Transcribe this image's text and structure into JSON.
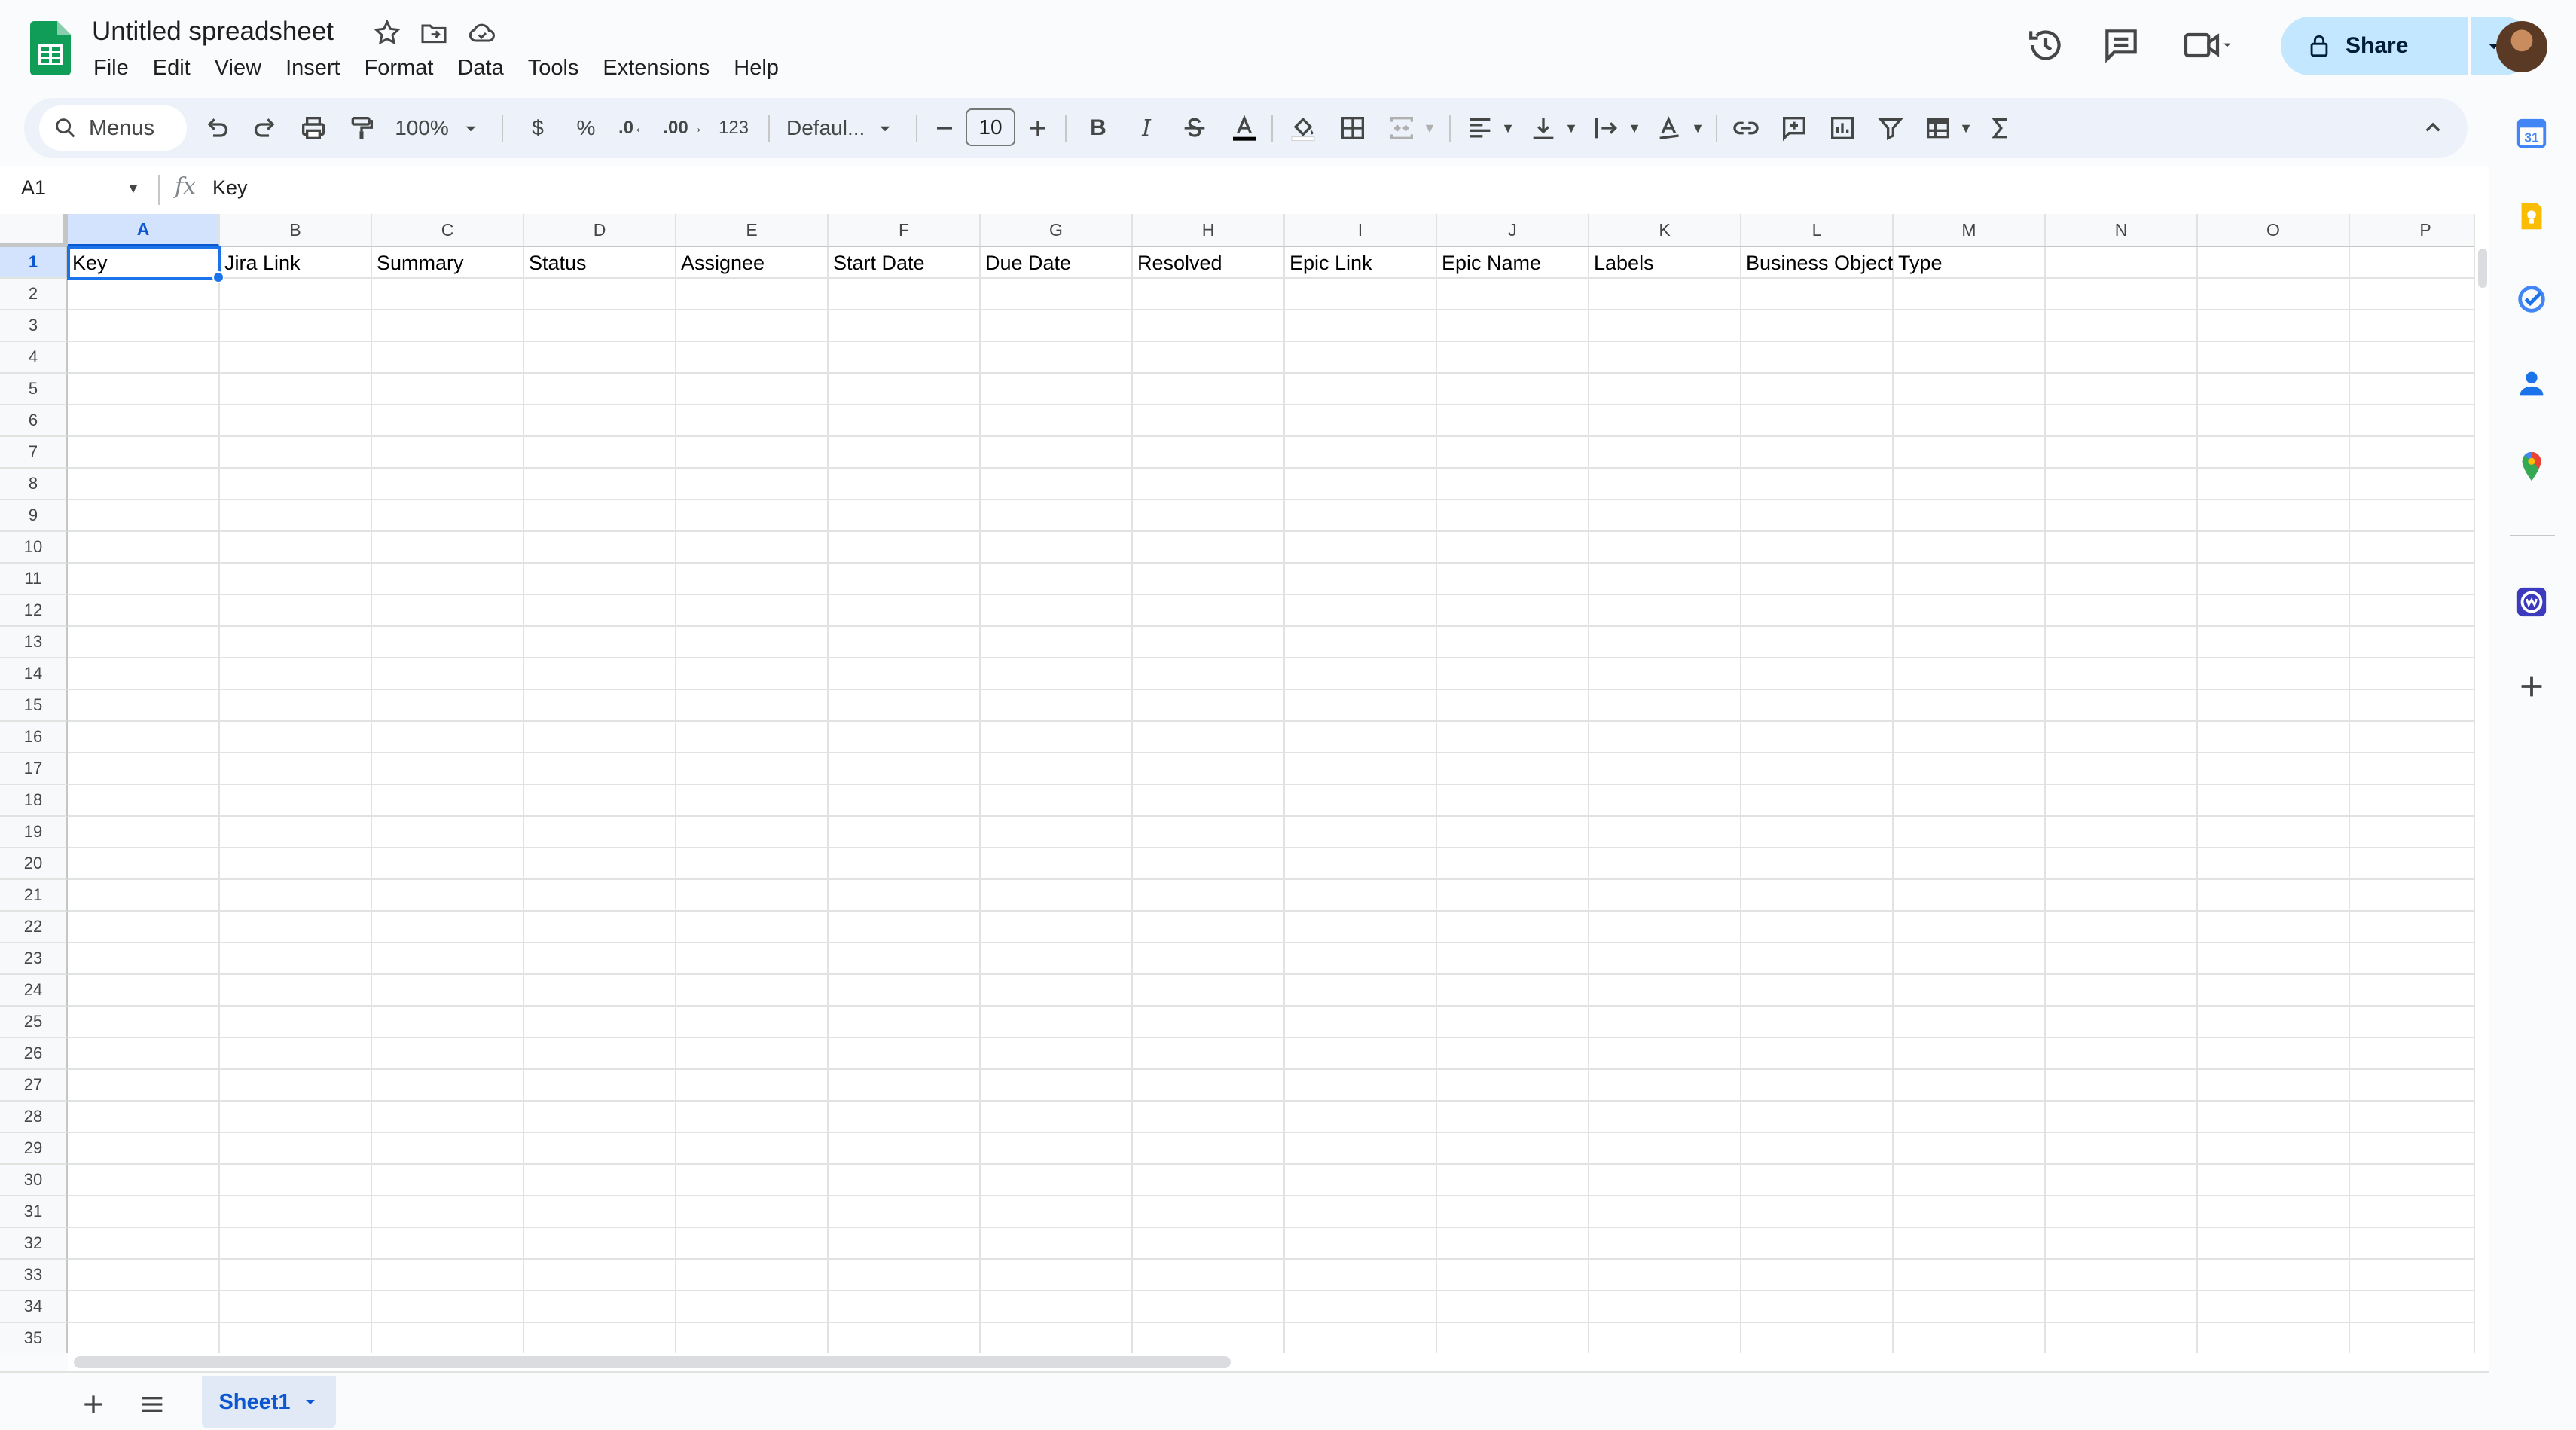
{
  "document": {
    "title": "Untitled spreadsheet"
  },
  "menu": [
    "File",
    "Edit",
    "View",
    "Insert",
    "Format",
    "Data",
    "Tools",
    "Extensions",
    "Help"
  ],
  "header": {
    "share_label": "Share"
  },
  "toolbar": {
    "search_label": "Menus",
    "zoom": "100%",
    "currency_label": "$",
    "percent_label": "%",
    "decrease_decimal_label": ".0",
    "increase_decimal_label": ".00",
    "number_format_label": "123",
    "font": "Defaul...",
    "font_size": "10",
    "bold_label": "B",
    "italic_label": "I"
  },
  "formula_bar": {
    "cell_ref": "A1",
    "value": "Key"
  },
  "grid": {
    "columns": [
      "A",
      "B",
      "C",
      "D",
      "E",
      "F",
      "G",
      "H",
      "I",
      "J",
      "K",
      "L",
      "M",
      "N",
      "O",
      "P"
    ],
    "row_count": 35,
    "header_row": [
      "Key",
      "Jira Link",
      "Summary",
      "Status",
      "Assignee",
      "Start Date",
      "Due Date",
      "Resolved",
      "Epic Link",
      "Epic Name",
      "Labels",
      "Business Object",
      "Type",
      "",
      "",
      ""
    ],
    "selected_cell": "A1"
  },
  "sheets": [
    {
      "name": "Sheet1",
      "active": true
    }
  ],
  "colors": {
    "accent": "#0b57d0",
    "share_bg": "#c2e7ff",
    "sheets_green": "#0f9d58",
    "selection": "#1a73e8"
  }
}
